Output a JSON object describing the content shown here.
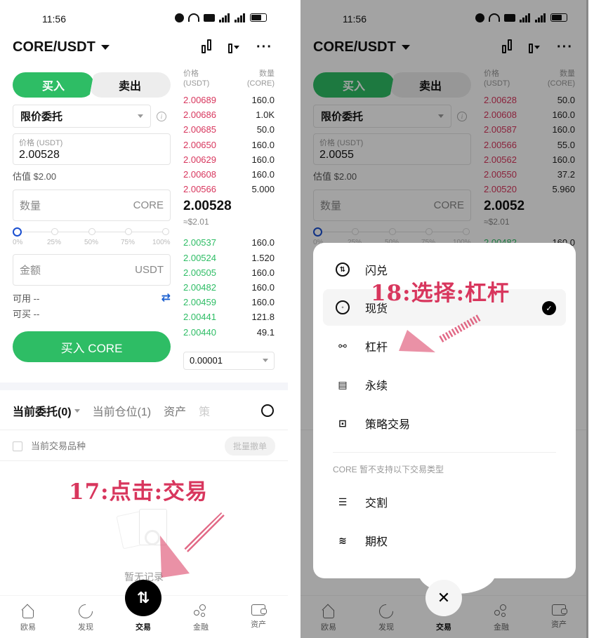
{
  "status": {
    "time": "11:56",
    "icons": [
      "alarm-icon",
      "wifi-icon",
      "hd-icon",
      "5g-signal-icon",
      "4g-signal-icon",
      "battery-icon"
    ]
  },
  "header": {
    "pair": "CORE/USDT",
    "icons": [
      "candlestick-compare-icon",
      "candlestick-menu-icon",
      "more-icon"
    ]
  },
  "form": {
    "buy_label": "买入",
    "sell_label": "卖出",
    "order_type": "限价委托",
    "price_label": "价格 (USDT)",
    "estimate_label": "估值 $2.00",
    "quantity_placeholder": "数量",
    "quantity_unit": "CORE",
    "slider_value_percent": 0,
    "slider_labels": [
      "0%",
      "25%",
      "50%",
      "75%",
      "100%"
    ],
    "amount_placeholder": "金额",
    "amount_unit": "USDT",
    "available_label": "可用 --",
    "can_buy_label": "可买 --",
    "buy_button": "买入 CORE"
  },
  "book_head": {
    "price": "价格",
    "price_unit": "(USDT)",
    "qty": "数量",
    "qty_unit": "(CORE)"
  },
  "left": {
    "price_value": "2.00528",
    "asks": [
      {
        "p": "2.00689",
        "q": "160.0"
      },
      {
        "p": "2.00686",
        "q": "1.0K"
      },
      {
        "p": "2.00685",
        "q": "50.0"
      },
      {
        "p": "2.00650",
        "q": "160.0"
      },
      {
        "p": "2.00629",
        "q": "160.0"
      },
      {
        "p": "2.00608",
        "q": "160.0"
      },
      {
        "p": "2.00566",
        "q": "5.000"
      }
    ],
    "mid_price": "2.00528",
    "mid_usd": "≈$2.01",
    "bids": [
      {
        "p": "2.00537",
        "q": "160.0"
      },
      {
        "p": "2.00524",
        "q": "1.520"
      },
      {
        "p": "2.00505",
        "q": "160.0"
      },
      {
        "p": "2.00482",
        "q": "160.0"
      },
      {
        "p": "2.00459",
        "q": "160.0"
      },
      {
        "p": "2.00441",
        "q": "121.8"
      },
      {
        "p": "2.00440",
        "q": "49.1"
      }
    ],
    "tick_size": "0.00001"
  },
  "right": {
    "price_value": "2.0055",
    "asks": [
      {
        "p": "2.00628",
        "q": "50.0"
      },
      {
        "p": "2.00608",
        "q": "160.0"
      },
      {
        "p": "2.00587",
        "q": "160.0"
      },
      {
        "p": "2.00566",
        "q": "55.0"
      },
      {
        "p": "2.00562",
        "q": "160.0"
      },
      {
        "p": "2.00550",
        "q": "37.2"
      },
      {
        "p": "2.00520",
        "q": "5.960"
      }
    ],
    "mid_price": "2.0052",
    "mid_usd": "≈$2.01",
    "bids": [
      {
        "p": "2.00482",
        "q": "160.0"
      }
    ]
  },
  "tabs": {
    "open_orders": "当前委托(0)",
    "positions": "当前仓位(1)",
    "assets": "资产",
    "strategy": "策"
  },
  "filter": {
    "current_pair": "当前交易品种",
    "batch_cancel": "批量撤单"
  },
  "empty": "暂无记录",
  "nav": [
    {
      "label": "欧易",
      "icon": "home-icon"
    },
    {
      "label": "发现",
      "icon": "discover-icon"
    },
    {
      "label": "交易",
      "icon": "trade-icon"
    },
    {
      "label": "金融",
      "icon": "finance-icon"
    },
    {
      "label": "资产",
      "icon": "wallet-icon"
    }
  ],
  "menu": {
    "items": [
      {
        "label": "闪兑",
        "icon": "convert-icon",
        "selected": false
      },
      {
        "label": "现货",
        "icon": "spot-icon",
        "selected": true
      },
      {
        "label": "杠杆",
        "icon": "margin-icon",
        "selected": false
      },
      {
        "label": "永续",
        "icon": "perpetual-icon",
        "selected": false
      },
      {
        "label": "策略交易",
        "icon": "bot-icon",
        "selected": false
      }
    ],
    "unsupported_note": "CORE 暂不支持以下交易类型",
    "unsupported": [
      {
        "label": "交割",
        "icon": "futures-icon"
      },
      {
        "label": "期权",
        "icon": "options-icon"
      }
    ]
  },
  "annotations": {
    "left": "17:点击:交易",
    "right": "18:选择:杠杆",
    "color": "#d8365d"
  },
  "colors": {
    "buy_green": "#2ebd65",
    "ask_red": "#d8365d",
    "slider_blue": "#1a4fd0"
  }
}
